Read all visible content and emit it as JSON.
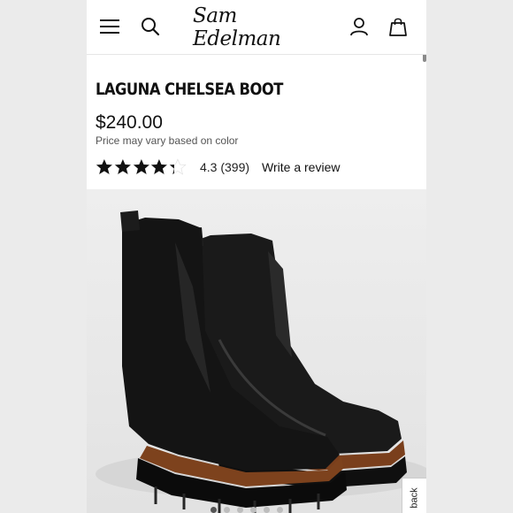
{
  "header": {
    "logo": "Sam Edelman",
    "icons": {
      "menu": "hamburger-menu-icon",
      "search": "search-icon",
      "account": "user-icon",
      "bag": "shopping-bag-icon"
    }
  },
  "product": {
    "title": "LAGUNA CHELSEA BOOT",
    "price": "$240.00",
    "price_note": "Price may vary based on color",
    "rating": {
      "stars_value": 4.3,
      "stars_max": 5,
      "text": "4.3 (399)",
      "review_link": "Write a review"
    },
    "image_alt": "black leather chelsea boots with brown lug sole"
  },
  "feedback": {
    "label": "back"
  },
  "carousel": {
    "count": 6,
    "active_index": 0
  },
  "colors": {
    "frame": "#ebebeb",
    "text": "#111111",
    "star": "#111111"
  }
}
